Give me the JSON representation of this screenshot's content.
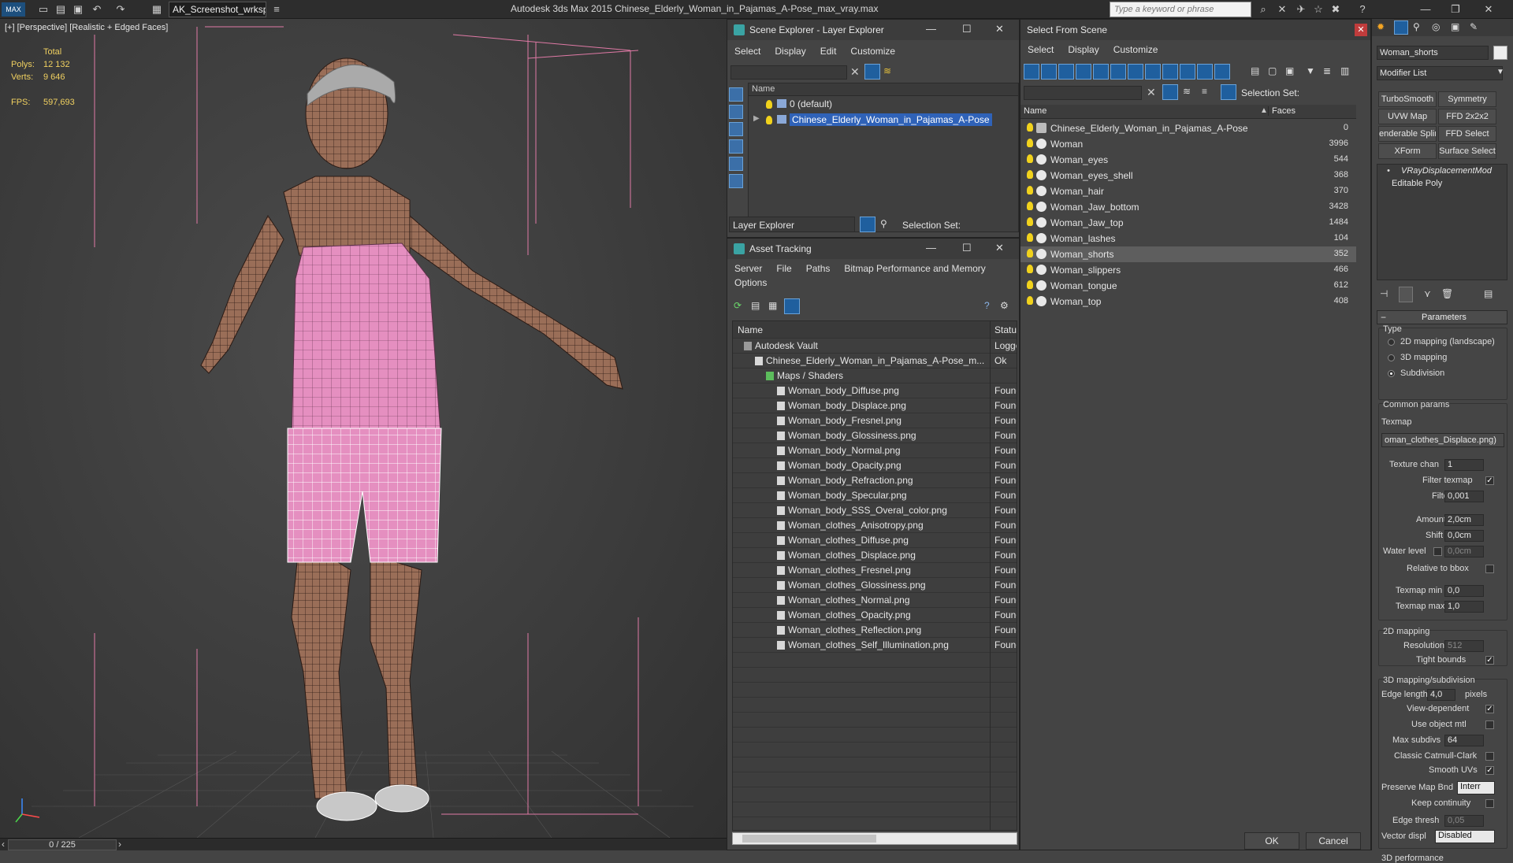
{
  "titlebar": {
    "workspace": "AK_Screenshot_wrksp",
    "app_title": "Autodesk 3ds Max  2015     Chinese_Elderly_Woman_in_Pajamas_A-Pose_max_vray.max",
    "search_placeholder": "Type a keyword or phrase"
  },
  "viewport": {
    "label": "[+] [Perspective] [Realistic + Edged Faces]",
    "stats": {
      "total_label": "Total",
      "polys_label": "Polys:",
      "polys": "12 132",
      "verts_label": "Verts:",
      "verts": "9 646",
      "fps_label": "FPS:",
      "fps": "597,693"
    },
    "frame_counter": "0 / 225"
  },
  "scene_explorer": {
    "title": "Scene Explorer - Layer Explorer",
    "menu": [
      "Select",
      "Display",
      "Edit",
      "Customize"
    ],
    "column_name": "Name",
    "layers": [
      {
        "label": "0 (default)",
        "selected": false
      },
      {
        "label": "Chinese_Elderly_Woman_in_Pajamas_A-Pose",
        "selected": true
      }
    ],
    "explorer_type": "Layer Explorer",
    "selection_set_label": "Selection Set:"
  },
  "asset_tracking": {
    "title": "Asset Tracking",
    "menu": [
      "Server",
      "File",
      "Paths",
      "Bitmap Performance and Memory"
    ],
    "menu2": [
      "Options"
    ],
    "col_name": "Name",
    "col_status": "Status",
    "rows": [
      {
        "name": "Autodesk Vault",
        "status": "Logged",
        "indent": 1
      },
      {
        "name": "Chinese_Elderly_Woman_in_Pajamas_A-Pose_m...",
        "status": "Ok",
        "indent": 2
      },
      {
        "name": "Maps / Shaders",
        "status": "",
        "indent": 3
      },
      {
        "name": "Woman_body_Diffuse.png",
        "status": "Found",
        "indent": 4
      },
      {
        "name": "Woman_body_Displace.png",
        "status": "Found",
        "indent": 4
      },
      {
        "name": "Woman_body_Fresnel.png",
        "status": "Found",
        "indent": 4
      },
      {
        "name": "Woman_body_Glossiness.png",
        "status": "Found",
        "indent": 4
      },
      {
        "name": "Woman_body_Normal.png",
        "status": "Found",
        "indent": 4
      },
      {
        "name": "Woman_body_Opacity.png",
        "status": "Found",
        "indent": 4
      },
      {
        "name": "Woman_body_Refraction.png",
        "status": "Found",
        "indent": 4
      },
      {
        "name": "Woman_body_Specular.png",
        "status": "Found",
        "indent": 4
      },
      {
        "name": "Woman_body_SSS_Overal_color.png",
        "status": "Found",
        "indent": 4
      },
      {
        "name": "Woman_clothes_Anisotropy.png",
        "status": "Found",
        "indent": 4
      },
      {
        "name": "Woman_clothes_Diffuse.png",
        "status": "Found",
        "indent": 4
      },
      {
        "name": "Woman_clothes_Displace.png",
        "status": "Found",
        "indent": 4
      },
      {
        "name": "Woman_clothes_Fresnel.png",
        "status": "Found",
        "indent": 4
      },
      {
        "name": "Woman_clothes_Glossiness.png",
        "status": "Found",
        "indent": 4
      },
      {
        "name": "Woman_clothes_Normal.png",
        "status": "Found",
        "indent": 4
      },
      {
        "name": "Woman_clothes_Opacity.png",
        "status": "Found",
        "indent": 4
      },
      {
        "name": "Woman_clothes_Reflection.png",
        "status": "Found",
        "indent": 4
      },
      {
        "name": "Woman_clothes_Self_Illumination.png",
        "status": "Found",
        "indent": 4
      }
    ]
  },
  "select_from_scene": {
    "title": "Select From Scene",
    "menu": [
      "Select",
      "Display",
      "Customize"
    ],
    "selection_set_label": "Selection Set:",
    "col_name": "Name",
    "col_faces": "Faces",
    "objects": [
      {
        "name": "Chinese_Elderly_Woman_in_Pajamas_A-Pose",
        "faces": "0",
        "selected": false
      },
      {
        "name": "Woman",
        "faces": "3996",
        "selected": false
      },
      {
        "name": "Woman_eyes",
        "faces": "544",
        "selected": false
      },
      {
        "name": "Woman_eyes_shell",
        "faces": "368",
        "selected": false
      },
      {
        "name": "Woman_hair",
        "faces": "370",
        "selected": false
      },
      {
        "name": "Woman_Jaw_bottom",
        "faces": "3428",
        "selected": false
      },
      {
        "name": "Woman_Jaw_top",
        "faces": "1484",
        "selected": false
      },
      {
        "name": "Woman_lashes",
        "faces": "104",
        "selected": false
      },
      {
        "name": "Woman_shorts",
        "faces": "352",
        "selected": true
      },
      {
        "name": "Woman_slippers",
        "faces": "466",
        "selected": false
      },
      {
        "name": "Woman_tongue",
        "faces": "612",
        "selected": false
      },
      {
        "name": "Woman_top",
        "faces": "408",
        "selected": false
      }
    ],
    "ok_label": "OK",
    "cancel_label": "Cancel"
  },
  "command_panel": {
    "object_name": "Woman_shorts",
    "modifier_list": "Modifier List",
    "modifier_buttons": [
      "TurboSmooth",
      "Symmetry",
      "UVW Map",
      "FFD 2x2x2",
      "enderable Splin",
      "FFD Select",
      "XForm",
      "Surface Select"
    ],
    "stack": [
      "VRayDisplacementMod",
      "Editable Poly"
    ],
    "parameters_title": "Parameters",
    "type_label": "Type",
    "type_options": [
      {
        "label": "2D mapping (landscape)",
        "on": false
      },
      {
        "label": "3D mapping",
        "on": false
      },
      {
        "label": "Subdivision",
        "on": true
      }
    ],
    "common_params": "Common params",
    "texmap_label": "Texmap",
    "texmap_value": "oman_clothes_Displace.png)",
    "texture_chan_label": "Texture chan",
    "texture_chan": "1",
    "filter_texmap_label": "Filter texmap",
    "filter_texmap": true,
    "filter_blur_label": "Filter blur",
    "filter_blur": "0,001",
    "amount_label": "Amount",
    "amount": "2,0cm",
    "shift_label": "Shift",
    "shift": "0,0cm",
    "water_level_label": "Water level",
    "water_level": "0,0cm",
    "relative_bbox_label": "Relative to bbox",
    "texmap_min_label": "Texmap min",
    "texmap_min": "0,0",
    "texmap_max_label": "Texmap max",
    "texmap_max": "1,0",
    "mapping2d_title": "2D mapping",
    "resolution_label": "Resolution",
    "resolution": "512",
    "tight_bounds_label": "Tight bounds",
    "mapping3d_title": "3D mapping/subdivision",
    "edge_length_label": "Edge length",
    "edge_length": "4,0",
    "pixels_label": "pixels",
    "view_dependent_label": "View-dependent",
    "use_object_mtl_label": "Use object mtl",
    "max_subdivs_label": "Max subdivs",
    "max_subdivs": "64",
    "classic_cc_label": "Classic Catmull-Clark",
    "smooth_uvs_label": "Smooth UVs",
    "preserve_map_label": "Preserve Map Bnd",
    "preserve_map_value": "Interr",
    "keep_continuity_label": "Keep continuity",
    "edge_thresh_label": "Edge thresh",
    "edge_thresh": "0,05",
    "vector_displ_label": "Vector displ",
    "vector_displ_value": "Disabled",
    "performance_title": "3D performance"
  },
  "colors": {
    "selection_blue": "#2f62b8",
    "stat_yellow": "#f0d060",
    "skin": "#9a6e58",
    "pajama_pink": "#e58fc0"
  }
}
